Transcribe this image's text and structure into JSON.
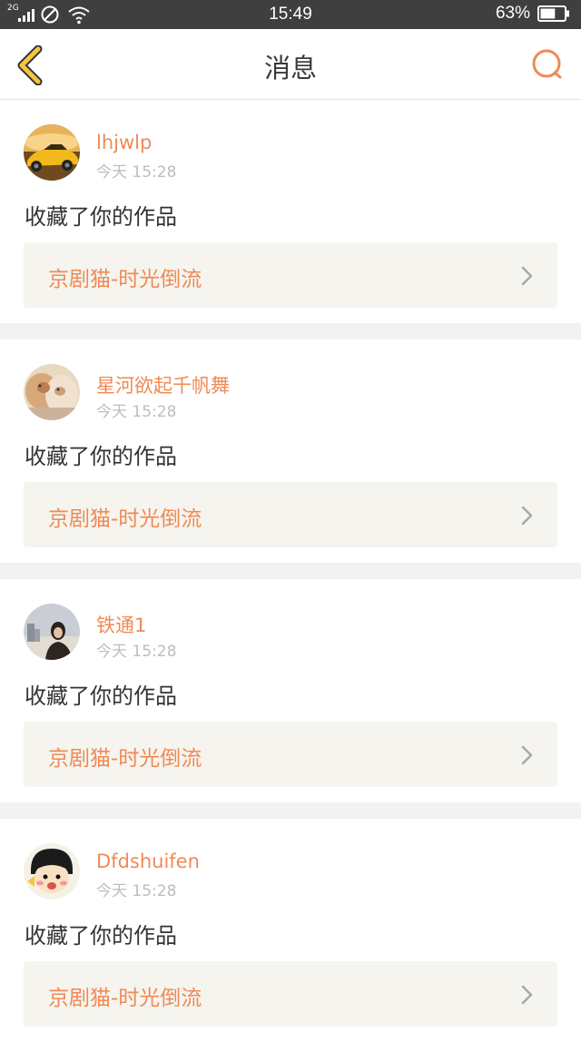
{
  "status_bar": {
    "network": "2G",
    "time": "15:49",
    "battery": "63%",
    "battery_level": 0.63,
    "icons": [
      "signal-icon",
      "do-not-disturb-icon",
      "wifi-icon",
      "battery-icon"
    ]
  },
  "header": {
    "title": "消息",
    "back_icon": "chevron-left-icon",
    "search_icon": "search-icon"
  },
  "colors": {
    "accent": "#ef8a55",
    "back_icon": "#f3c542",
    "work_background": "#f5f4ef",
    "status_bar": "#3f3f3f"
  },
  "messages": [
    {
      "username": "lhjwlp",
      "time": "今天 15:28",
      "action": "收藏了你的作品",
      "work_title": "京剧猫-时光倒流",
      "avatar": "yellow-car-avatar"
    },
    {
      "username": "星河欲起千帆舞",
      "time": "今天 15:28",
      "action": "收藏了你的作品",
      "work_title": "京剧猫-时光倒流",
      "avatar": "cats-avatar"
    },
    {
      "username": "铁通1",
      "time": "今天 15:28",
      "action": "收藏了你的作品",
      "work_title": "京剧猫-时光倒流",
      "avatar": "woman-portrait-avatar"
    },
    {
      "username": "Dfdshuifen",
      "time": "今天 15:28",
      "action": "收藏了你的作品",
      "work_title": "京剧猫-时光倒流",
      "avatar": "cartoon-girl-avatar"
    }
  ]
}
